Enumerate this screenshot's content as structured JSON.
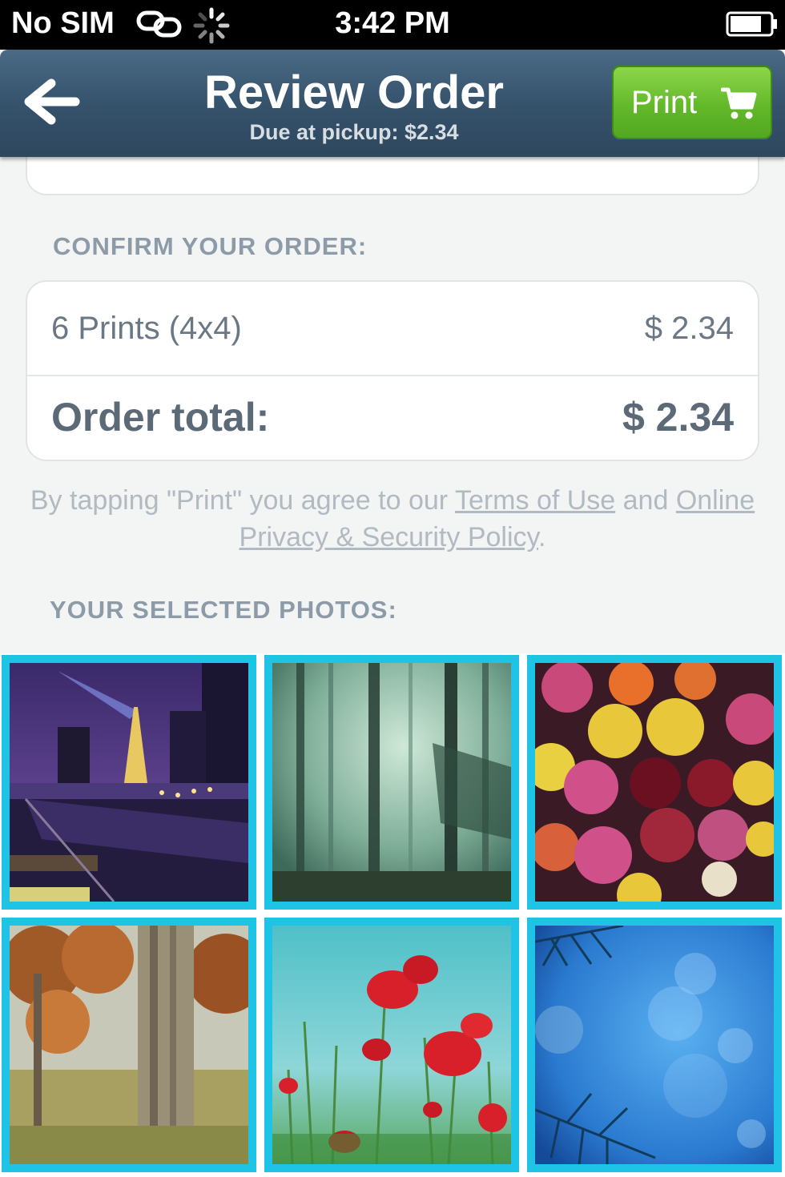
{
  "status_bar": {
    "carrier": "No SIM",
    "time": "3:42 PM",
    "icons": [
      "link-icon",
      "activity-spinner-icon",
      "battery-icon"
    ]
  },
  "nav": {
    "back_icon": "back-arrow-icon",
    "title": "Review Order",
    "subtitle": "Due at pickup: $2.34",
    "print_label": "Print",
    "print_icon": "cart-icon"
  },
  "confirm": {
    "heading": "CONFIRM YOUR ORDER:",
    "line_item_label": "6 Prints (4x4)",
    "line_item_price": "$ 2.34",
    "total_label": "Order total:",
    "total_price": "$ 2.34"
  },
  "terms": {
    "prefix": "By tapping \"Print\" you agree to our ",
    "terms_link": "Terms of Use",
    "middle": " and ",
    "privacy_link": "Online Privacy & Security Policy",
    "suffix": "."
  },
  "photos": {
    "heading": "YOUR SELECTED PHOTOS:",
    "selection_color": "#1ec3e6"
  },
  "colors": {
    "nav_bar": "#36536c",
    "print_button": "#63b92a",
    "heading_text": "#8d9ba8",
    "background": "#f3f4f4"
  }
}
